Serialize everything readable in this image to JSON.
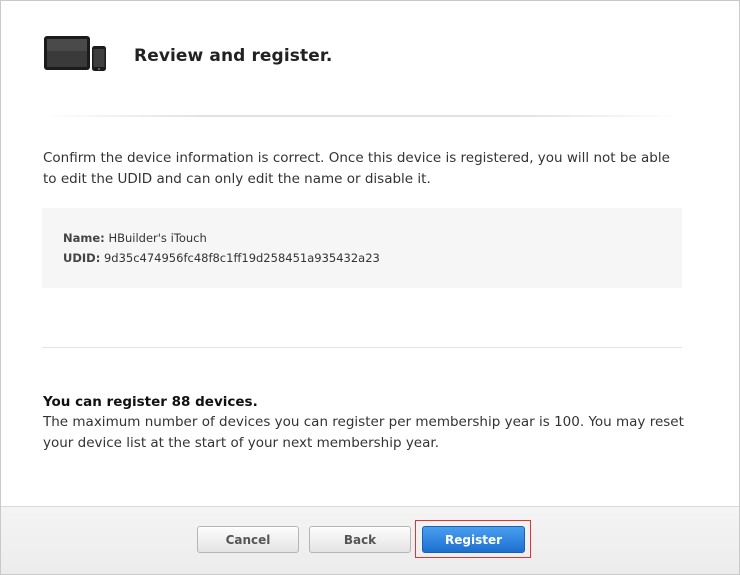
{
  "header": {
    "title": "Review and register."
  },
  "confirm": {
    "text": "Confirm the device information is correct. Once this device is registered, you will not be able to edit the UDID and can only edit the name or disable it."
  },
  "device_info": {
    "name_label": "Name:",
    "name_value": "HBuilder's iTouch",
    "udid_label": "UDID:",
    "udid_value": "9d35c474956fc48f8c1ff19d258451a935432a23"
  },
  "limit": {
    "heading": "You can register 88 devices.",
    "text": "The maximum number of devices you can register per membership year is 100. You may reset your device list at the start of your next membership year."
  },
  "footer": {
    "cancel_label": "Cancel",
    "back_label": "Back",
    "register_label": "Register"
  },
  "icons": {
    "header_icon": "devices-icon"
  },
  "colors": {
    "primary_button": "#1d6fcf",
    "highlight_outline": "#e23232"
  }
}
